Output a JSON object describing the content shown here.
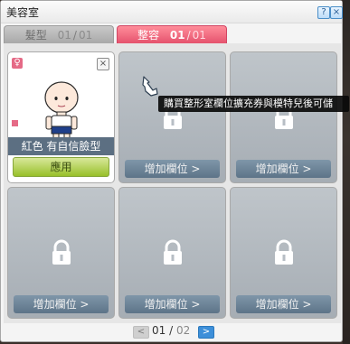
{
  "window": {
    "title": "美容室",
    "buttons": {
      "help_label": "?",
      "close_label": "×"
    }
  },
  "tabs": [
    {
      "label": "髮型",
      "current": "01",
      "separator": "/",
      "total": "01"
    },
    {
      "label": "整容",
      "current": "01",
      "separator": "/",
      "total": "01"
    }
  ],
  "selected_slot": {
    "gender_badge": "♀",
    "delete_label": "×",
    "name": "紅色 有自信臉型",
    "apply_label": "應用"
  },
  "locked_slot": {
    "add_label": "增加欄位 >"
  },
  "tooltip": {
    "text": "購買整形室欄位擴充券與模特兒後可儲"
  },
  "pagination": {
    "prev_label": "<",
    "current": "01",
    "separator": "/",
    "total": "02",
    "next_label": ">"
  },
  "colors": {
    "active_tab": "#e44f6b",
    "apply_button": "#98c02a",
    "locked_slot": "#b3bac0",
    "add_button": "#6f8599",
    "next_page": "#3d8fd9"
  },
  "icons": {
    "lock": "lock-icon",
    "cursor": "hand-pointer-icon"
  }
}
